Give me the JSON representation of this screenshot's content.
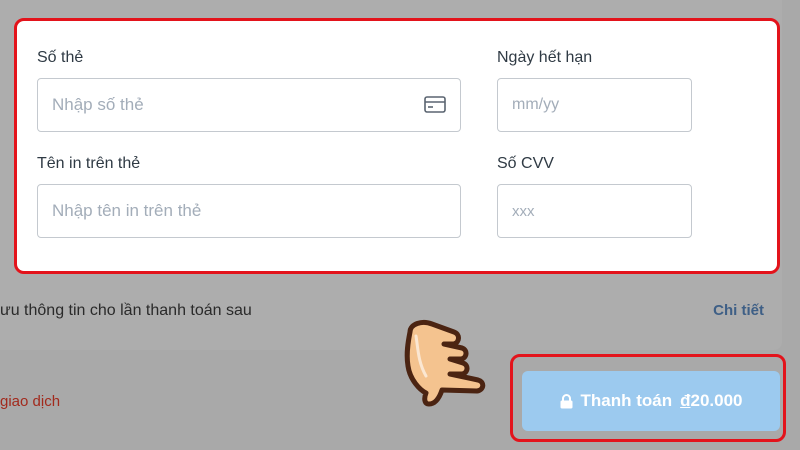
{
  "form": {
    "card_number": {
      "label": "Số thẻ",
      "placeholder": "Nhập số thẻ",
      "value": ""
    },
    "expiry": {
      "label": "Ngày hết hạn",
      "placeholder": "mm/yy",
      "value": ""
    },
    "cardholder": {
      "label": "Tên in trên thẻ",
      "placeholder": "Nhập tên in trên thẻ",
      "value": ""
    },
    "cvv": {
      "label": "Số CVV",
      "placeholder": "xxx",
      "value": ""
    }
  },
  "save_info": {
    "label": "ưu thông tin cho lần thanh toán sau",
    "detail_link": "Chi tiết"
  },
  "transaction": {
    "label": "giao dịch"
  },
  "pay": {
    "label": "Thanh toán",
    "currency_symbol": "đ",
    "amount": "20.000"
  },
  "icons": {
    "card": "credit-card-icon",
    "lock": "lock-icon",
    "pointer": "pointing-hand-icon"
  },
  "colors": {
    "highlight": "#e3131b",
    "button": "#9ccaef",
    "link": "#3e5f86",
    "danger_link": "#a22a1d"
  }
}
